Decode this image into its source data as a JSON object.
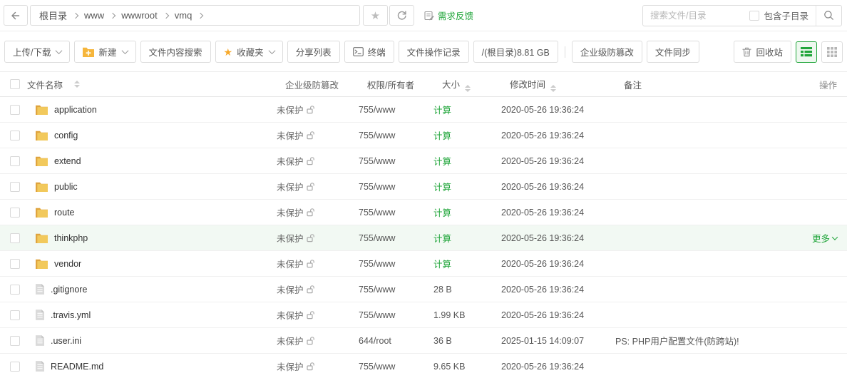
{
  "topbar": {
    "breadcrumb": [
      "根目录",
      "www",
      "wwwroot",
      "vmq"
    ],
    "feedback_label": "需求反馈",
    "search_placeholder": "搜索文件/目录",
    "include_sub_label": "包含子目录"
  },
  "toolbar": {
    "upload_download_label": "上传/下载",
    "new_label": "新建",
    "content_search_label": "文件内容搜索",
    "favorites_label": "收藏夹",
    "share_list_label": "分享列表",
    "terminal_label": "终端",
    "file_ops_log_label": "文件操作记录",
    "disk_usage_label": "/(根目录)8.81 GB",
    "tamper_proof_label": "企业级防篡改",
    "file_sync_label": "文件同步",
    "recycle_bin_label": "回收站"
  },
  "table": {
    "headers": {
      "name": "文件名称",
      "tamper": "企业级防篡改",
      "perm": "权限/所有者",
      "size": "大小",
      "mtime": "修改时间",
      "note": "备注",
      "action": "操作"
    },
    "rows": [
      {
        "name": "application",
        "type": "folder",
        "tamper": "未保护",
        "perm": "755/www",
        "size": "计算",
        "size_link": true,
        "mtime": "2020-05-26 19:36:24",
        "note": "",
        "action": ""
      },
      {
        "name": "config",
        "type": "folder",
        "tamper": "未保护",
        "perm": "755/www",
        "size": "计算",
        "size_link": true,
        "mtime": "2020-05-26 19:36:24",
        "note": "",
        "action": ""
      },
      {
        "name": "extend",
        "type": "folder",
        "tamper": "未保护",
        "perm": "755/www",
        "size": "计算",
        "size_link": true,
        "mtime": "2020-05-26 19:36:24",
        "note": "",
        "action": ""
      },
      {
        "name": "public",
        "type": "folder",
        "tamper": "未保护",
        "perm": "755/www",
        "size": "计算",
        "size_link": true,
        "mtime": "2020-05-26 19:36:24",
        "note": "",
        "action": ""
      },
      {
        "name": "route",
        "type": "folder",
        "tamper": "未保护",
        "perm": "755/www",
        "size": "计算",
        "size_link": true,
        "mtime": "2020-05-26 19:36:24",
        "note": "",
        "action": ""
      },
      {
        "name": "thinkphp",
        "type": "folder",
        "tamper": "未保护",
        "perm": "755/www",
        "size": "计算",
        "size_link": true,
        "mtime": "2020-05-26 19:36:24",
        "note": "",
        "action": "更多",
        "highlight": true
      },
      {
        "name": "vendor",
        "type": "folder",
        "tamper": "未保护",
        "perm": "755/www",
        "size": "计算",
        "size_link": true,
        "mtime": "2020-05-26 19:36:24",
        "note": "",
        "action": ""
      },
      {
        "name": ".gitignore",
        "type": "file",
        "tamper": "未保护",
        "perm": "755/www",
        "size": "28 B",
        "size_link": false,
        "mtime": "2020-05-26 19:36:24",
        "note": "",
        "action": ""
      },
      {
        "name": ".travis.yml",
        "type": "file",
        "tamper": "未保护",
        "perm": "755/www",
        "size": "1.99 KB",
        "size_link": false,
        "mtime": "2020-05-26 19:36:24",
        "note": "",
        "action": ""
      },
      {
        "name": ".user.ini",
        "type": "file",
        "tamper": "未保护",
        "perm": "644/root",
        "size": "36 B",
        "size_link": false,
        "mtime": "2025-01-15 14:09:07",
        "note": "PS: PHP用户配置文件(防跨站)!",
        "action": ""
      },
      {
        "name": "README.md",
        "type": "file",
        "tamper": "未保护",
        "perm": "755/www",
        "size": "9.65 KB",
        "size_link": false,
        "mtime": "2020-05-26 19:36:24",
        "note": "",
        "action": ""
      }
    ]
  },
  "colors": {
    "accent": "#20a53a",
    "folder": "#f2c95c",
    "star": "#f7a92b"
  }
}
